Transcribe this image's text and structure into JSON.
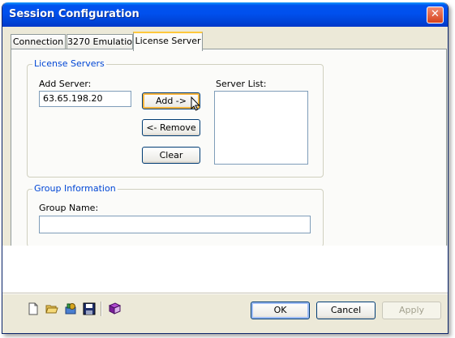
{
  "window": {
    "title": "Session Configuration",
    "close_label": "✕"
  },
  "tabs": [
    {
      "label": "Connection",
      "active": false
    },
    {
      "label": "3270 Emulation",
      "active": false
    },
    {
      "label": "License Server",
      "active": true
    }
  ],
  "license_servers": {
    "group_label": "License Servers",
    "add_server_label": "Add Server:",
    "add_server_value": "63.65.198.20",
    "server_list_label": "Server List:",
    "server_list_items": [],
    "add_button": "Add  ->",
    "remove_button": "<- Remove",
    "clear_button": "Clear"
  },
  "group_information": {
    "group_label": "Group Information",
    "group_name_label": "Group Name:",
    "group_name_value": ""
  },
  "toolbar": {
    "icons": [
      "new-document-icon",
      "open-folder-icon",
      "settings-icon",
      "save-icon",
      "book-icon"
    ]
  },
  "buttons": {
    "ok": "OK",
    "cancel": "Cancel",
    "apply": "Apply"
  },
  "colors": {
    "title_bar": "#0053ee",
    "group_label": "#0046d5",
    "active_tab_accent": "#ffc83c",
    "hover_button_border": "#f9b53e"
  }
}
